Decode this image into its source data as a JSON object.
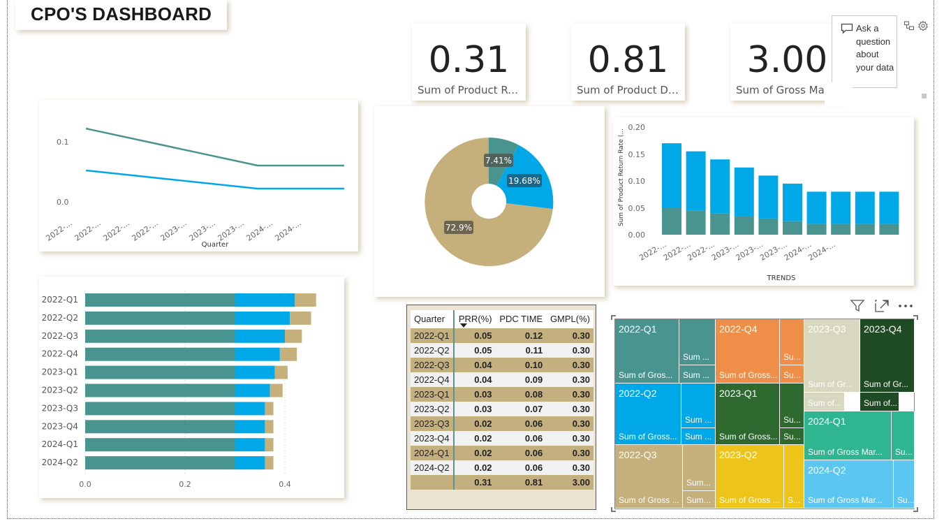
{
  "title": "CPO'S DASHBOARD",
  "kpis": [
    {
      "value": "0.31",
      "label": "Sum of Product Re..."
    },
    {
      "value": "0.81",
      "label": "Sum of Product De..."
    },
    {
      "value": "3.00",
      "label": "Sum of Gross Marg"
    }
  ],
  "qa": {
    "label": "Ask a question about your data"
  },
  "line_chart": {
    "type": "line",
    "xlabel": "Quarter",
    "ytick_labels": [
      "0.1",
      "0.0"
    ],
    "xtick_labels": [
      "2022-...",
      "2022-...",
      "2022-...",
      "2022-...",
      "2023-...",
      "2023-...",
      "2023-...",
      "2024-...",
      "2024-..."
    ],
    "colors": [
      "#4a9490",
      "#00a8e8"
    ]
  },
  "pie_chart": {
    "labels": [
      "7.41%",
      "19.68%",
      "72.9%"
    ],
    "colors": [
      "#4a9490",
      "#00a8e8",
      "#c5af7a"
    ]
  },
  "bar_chart": {
    "ylabel": "Sum of Product Return Rate (...",
    "xlabel": "TRENDS",
    "ytick_labels": [
      "0.20",
      "0.15",
      "0.10",
      "0.05",
      "0.00"
    ],
    "xtick_labels": [
      "2022-...",
      "2022-...",
      "2022-...",
      "2023-...",
      "2023-...",
      "2023-...",
      "2024-...",
      "2024-..."
    ],
    "colors": [
      "#00a8e8",
      "#4a9490"
    ]
  },
  "hbar_chart": {
    "xtick_labels": [
      "0.0",
      "0.2",
      "0.4"
    ],
    "colors": [
      "#4a9490",
      "#00a8e8",
      "#c5af7a"
    ]
  },
  "table": {
    "headers": [
      "Quarter",
      "PRR(%)",
      "PDC TIME",
      "GMPL(%)"
    ],
    "rows": [
      [
        "2022-Q1",
        "0.05",
        "0.12",
        "0.30"
      ],
      [
        "2022-Q2",
        "0.05",
        "0.11",
        "0.30"
      ],
      [
        "2022-Q3",
        "0.04",
        "0.10",
        "0.30"
      ],
      [
        "2022-Q4",
        "0.04",
        "0.09",
        "0.30"
      ],
      [
        "2023-Q1",
        "0.03",
        "0.08",
        "0.30"
      ],
      [
        "2023-Q2",
        "0.03",
        "0.07",
        "0.30"
      ],
      [
        "2023-Q3",
        "0.02",
        "0.06",
        "0.30"
      ],
      [
        "2023-Q4",
        "0.02",
        "0.06",
        "0.30"
      ],
      [
        "2024-Q1",
        "0.02",
        "0.06",
        "0.30"
      ],
      [
        "2024-Q2",
        "0.02",
        "0.06",
        "0.30"
      ]
    ],
    "total": [
      "",
      "0.31",
      "0.81",
      "3.00"
    ]
  },
  "treemap": {
    "tiles": [
      {
        "head": "2022-Q1",
        "foot": "Sum of Gros...",
        "color": "#4a9490"
      },
      {
        "head": "",
        "foot": "Sum ...",
        "color": "#4a9490"
      },
      {
        "head": "",
        "foot": "Sum ...",
        "color": "#4a9490"
      },
      {
        "head": "2022-Q4",
        "foot": "Sum of Gross...",
        "color": "#ef8e48"
      },
      {
        "head": "",
        "foot": "Su...",
        "color": "#ef8e48"
      },
      {
        "head": "",
        "foot": "Su...",
        "color": "#ef8e48"
      },
      {
        "head": "2023-Q3",
        "foot": "Sum of Gr...",
        "color": "#d8d8c0"
      },
      {
        "head": "",
        "foot": "Sum of...",
        "color": "#d8d8c0"
      },
      {
        "head": "2023-Q4",
        "foot": "Sum of Gr...",
        "color": "#1e4a24"
      },
      {
        "head": "",
        "foot": "Sum of...",
        "color": "#1e4a24"
      },
      {
        "head": "2022-Q2",
        "foot": "Sum of Gross...",
        "color": "#00a8e8"
      },
      {
        "head": "",
        "foot": "Sum ...",
        "color": "#00a8e8"
      },
      {
        "head": "",
        "foot": "Sum ...",
        "color": "#00a8e8"
      },
      {
        "head": "2023-Q1",
        "foot": "Sum of Gross...",
        "color": "#2e6a30"
      },
      {
        "head": "",
        "foot": "Su...",
        "color": "#2e6a30"
      },
      {
        "head": "",
        "foot": "Su...",
        "color": "#2e6a30"
      },
      {
        "head": "2024-Q1",
        "foot": "Sum of Gross Mar...",
        "color": "#2fb58f"
      },
      {
        "head": "",
        "foot": "Su...",
        "color": "#2fb58f"
      },
      {
        "head": "2022-Q3",
        "foot": "Sum of Gross ...",
        "color": "#c5af7a"
      },
      {
        "head": "",
        "foot": "Sum...",
        "color": "#c5af7a"
      },
      {
        "head": "",
        "foot": "Sum...",
        "color": "#c5af7a"
      },
      {
        "head": "2023-Q2",
        "foot": "Sum of Gross ...",
        "color": "#eec31a"
      },
      {
        "head": "",
        "foot": "S...",
        "color": "#eec31a"
      },
      {
        "head": "2024-Q2",
        "foot": "Sum of Gross Mar...",
        "color": "#5bc6f0"
      },
      {
        "head": "",
        "foot": "Su...",
        "color": "#5bc6f0"
      }
    ]
  },
  "icons": [
    "comment-icon",
    "share-icon",
    "gear-icon",
    "filter-icon",
    "expand-icon",
    "more-options-icon"
  ]
}
